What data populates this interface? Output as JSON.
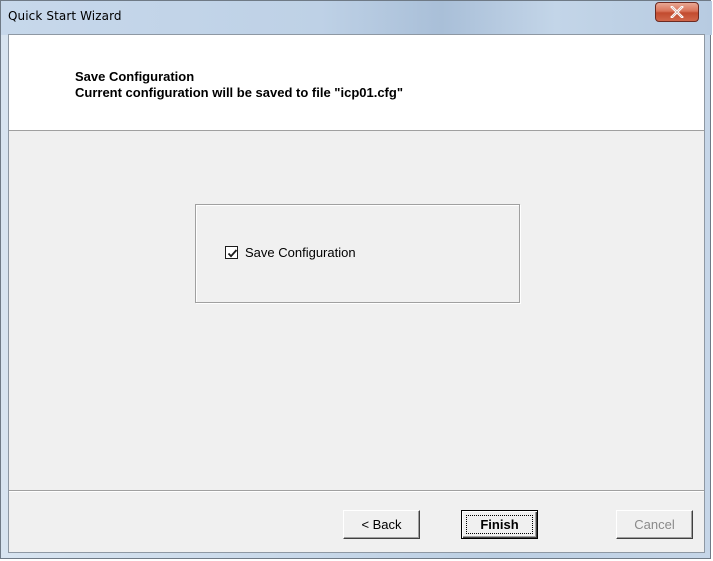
{
  "window": {
    "title": "Quick Start Wizard"
  },
  "header": {
    "title": "Save Configuration",
    "subtitle": "Current configuration will be saved to file \"icp01.cfg\""
  },
  "options": {
    "save_configuration_label": "Save Configuration",
    "save_configuration_checked": true
  },
  "buttons": {
    "back_label": "< Back",
    "finish_label": "Finish",
    "cancel_label": "Cancel",
    "cancel_enabled": false
  },
  "colors": {
    "close_button": "#c24b2f",
    "dialog_face": "#f0f0f0",
    "header_background": "#ffffff",
    "disabled_text": "#8a8a8a"
  },
  "icons": {
    "close": "close-icon",
    "checkmark": "checkmark-icon"
  }
}
